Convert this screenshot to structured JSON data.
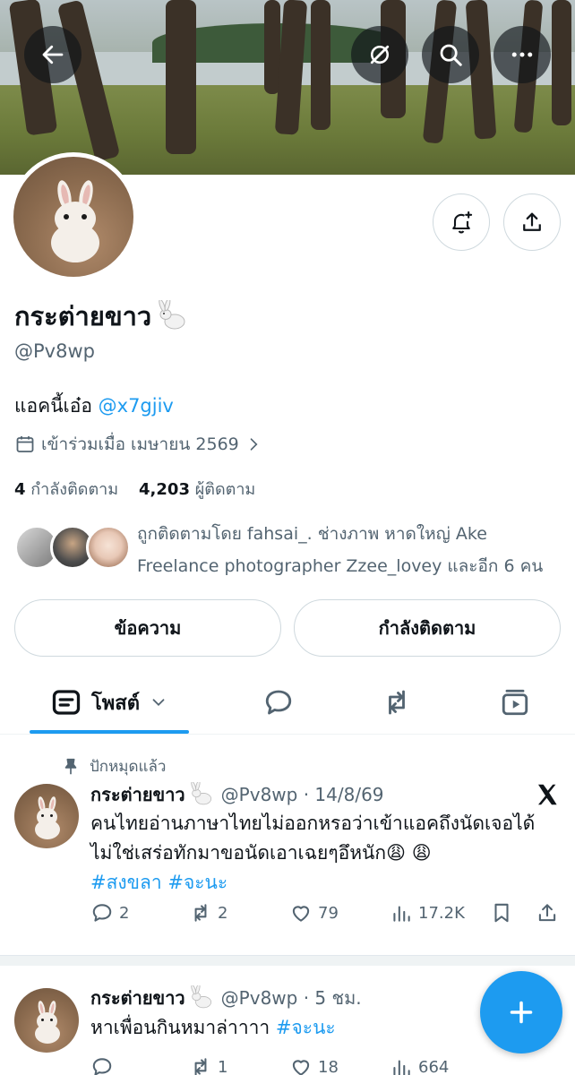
{
  "header": {
    "back_icon": "arrow-left-icon",
    "grok_icon": "grok-icon",
    "search_icon": "search-icon",
    "more_icon": "more-dots-icon"
  },
  "profile": {
    "name": "กระต่ายขาว",
    "name_emoji": "rabbit",
    "handle": "@Pv8wp",
    "bio_text": "แอคนี้เอ๋อ ",
    "bio_link": "@x7gjiv",
    "joined": "เข้าร่วมเมื่อ เมษายน 2569",
    "following_count": "4",
    "following_label": "กำลังติดตาม",
    "followers_count": "4,203",
    "followers_label": "ผู้ติดตาม",
    "followed_by": "ถูกติดตามโดย fahsai_. ช่างภาพ หาดใหญ่ Ake Freelance photographer Zzee_lovey และอีก 6 คน",
    "message_button": "ข้อความ",
    "following_button": "กำลังติดตาม",
    "notify_icon": "bell-plus-icon",
    "share_icon": "share-icon"
  },
  "tabs": {
    "posts_label": "โพสต์",
    "items": [
      "posts",
      "replies",
      "reposts",
      "media"
    ]
  },
  "posts": [
    {
      "pinned_label": "ปักหมุดแล้ว",
      "name": "กระต่ายขาว",
      "handle_time": "@Pv8wp · 14/8/69",
      "text": "คนไทยอ่านภาษาไทยไม่ออกหรอว่าเข้าแอคถึงนัดเจอได้ไม่ใช่เสร่อทักมาขอนัดเอาเฉยๆอึหนัก",
      "emoji": "😩 😩",
      "tags": "#สงขลา #จะนะ",
      "replies": "2",
      "reposts": "2",
      "likes": "79",
      "views": "17.2K"
    },
    {
      "name": "กระต่ายขาว",
      "handle_time": "@Pv8wp · 5 ชม.",
      "text": "หาเพื่อนกินหมาล่าาาา ",
      "tags": "#จะนะ",
      "replies": "",
      "reposts": "1",
      "likes": "18",
      "views": "664"
    }
  ],
  "fab": {
    "icon": "plus-icon"
  },
  "colors": {
    "accent": "#1d9bf0",
    "text": "#0f1419",
    "muted": "#536471",
    "border": "#cfd9de"
  }
}
